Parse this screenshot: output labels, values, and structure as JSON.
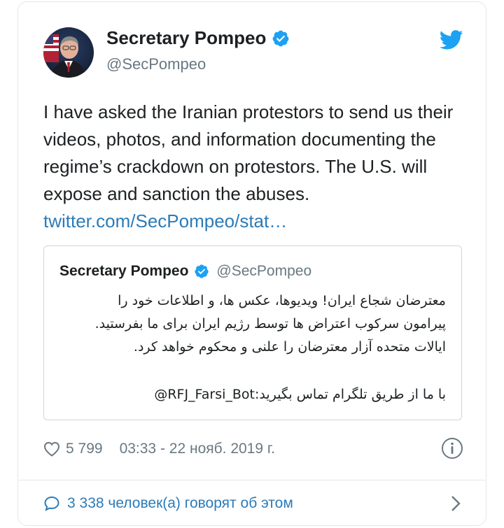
{
  "author": {
    "name": "Secretary Pompeo",
    "handle": "@SecPompeo"
  },
  "tweet": {
    "text": "I have asked the Iranian protestors to send us their videos, photos, and information documenting the regime’s crackdown on protestors. The U.S. will expose and sanction the abuses. ",
    "link": "twitter.com/SecPompeo/stat…"
  },
  "quoted": {
    "name": "Secretary Pompeo",
    "handle": "@SecPompeo",
    "lines": [
      "معترضان شجاع ایران! ویدیوها، عکس ها، و اطلاعات خود را",
      "پیرامون سرکوب اعتراض ها توسط رژیم ایران برای ما بفرستید.",
      "ایالات متحده آزار معترضان را علنی و محکوم خواهد کرد."
    ],
    "contact": "با ما از طریق تلگرام تماس بگیرید:RFJ_Farsi_Bot@"
  },
  "meta": {
    "likes": "5 799",
    "timestamp": "03:33 - 22 нояб. 2019 г."
  },
  "footer": {
    "replies_text": "3 338 человек(а) говорят об этом"
  },
  "colors": {
    "link": "#2b7bb9",
    "verified": "#1da1f2",
    "muted": "#697882",
    "twitter_blue": "#1da1f2"
  },
  "icons": [
    "verified-badge-icon",
    "twitter-bird-icon",
    "heart-icon",
    "info-icon",
    "comment-bubble-icon",
    "chevron-right-icon"
  ]
}
